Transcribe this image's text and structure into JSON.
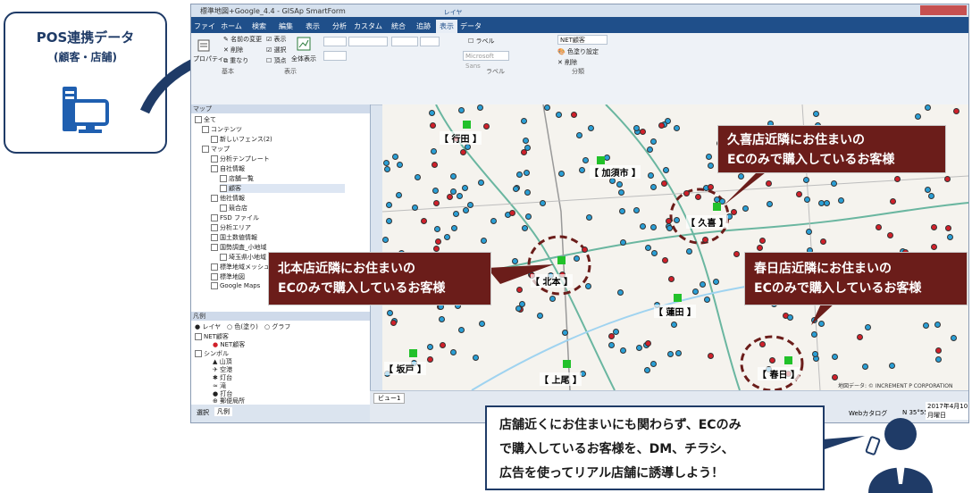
{
  "pos": {
    "title": "POS連携データ",
    "subtitle": "(顧客・店舗)"
  },
  "window": {
    "title": "標準地図+Google_4.4 - GISAp SmartForm",
    "tabs": [
      "ファイル",
      "ホーム",
      "検索",
      "編集",
      "表示",
      "分析",
      "カスタム",
      "統合",
      "追跡",
      "表示",
      "データ"
    ],
    "context_tab_label": "レイヤ"
  },
  "ribbon": {
    "property": "プロパティ",
    "rename": "名前の変更",
    "delete": "削除",
    "overlap": "重なり",
    "group_basic": "基本",
    "show": "表示",
    "select": "選択",
    "vertex": "頂点",
    "show_all": "全体表示",
    "group_display": "表示",
    "label": "ラベル",
    "font_name": "Microsoft Sans",
    "group_label": "ラベル",
    "net_customer": "NET顧客",
    "color_setting": "色塗り設定",
    "remove": "削除",
    "group_class": "分類"
  },
  "map_panel": {
    "header": "マップ",
    "items": [
      "全て",
      "コンテンツ",
      "新しいフェンス(2)",
      "マップ",
      "分析テンプレート",
      "自社情報",
      "店舗一覧",
      "顧客",
      "他社情報",
      "競合店",
      "FSD ファイル",
      "分析エリア",
      "国土数値情報",
      "国勢調査_小地域",
      "埼玉県小地域",
      "標準地域メッシュ",
      "標準地図",
      "Google Maps"
    ]
  },
  "legend_panel": {
    "header": "凡例",
    "radio": [
      "レイヤ",
      "色(塗り)",
      "グラフ"
    ],
    "items": [
      "NET顧客",
      "NET顧客",
      "シンボル",
      "山頂",
      "空港",
      "灯台",
      "滝",
      "打台",
      "郵便局所"
    ]
  },
  "bottom_tabs": [
    "選択",
    "凡例"
  ],
  "map_tab": "ビュー1",
  "status": {
    "web_catalog": "Webカタログ",
    "coord": "N 35°55'",
    "date": "2017年4月10日",
    "weekday": "月曜日",
    "copyright": "地図データ: © INCREMENT P CORPORATION"
  },
  "store_labels": [
    "【 行田 】",
    "【 加須市 】",
    "【 久喜 】",
    "【 北本 】",
    "【 蓮田 】",
    "【 坂戸 】",
    "【 上尾 】",
    "【 春日 】"
  ],
  "callouts": {
    "kuki": [
      "久喜店近隣にお住まいの",
      "ECのみで購入しているお客様"
    ],
    "kitamoto": [
      "北本店近隣にお住まいの",
      "ECのみで購入しているお客様"
    ],
    "kasukabe": [
      "春日店近隣にお住まいの",
      "ECのみで購入しているお客様"
    ]
  },
  "note": [
    "店舗近くにお住まいにも関わらず、ECのみ",
    "で購入しているお客様を、DM、チラシ、",
    "広告を使ってリアル店舗に誘導しよう！"
  ],
  "colors": {
    "navy": "#1f3b67",
    "callout": "#6b1d1a",
    "customer_blue": "#2a9fd6",
    "customer_red": "#d0202a",
    "store_green": "#22c12a"
  }
}
